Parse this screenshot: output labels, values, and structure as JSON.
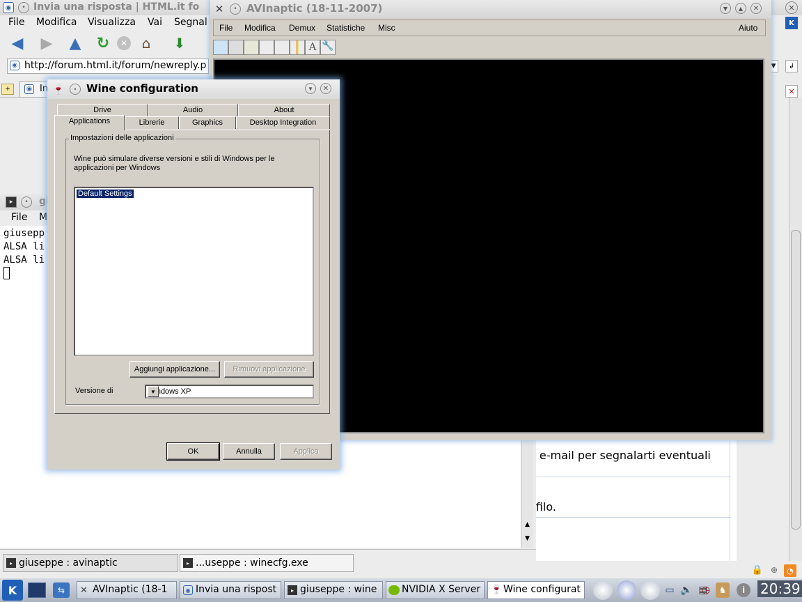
{
  "konqueror": {
    "title": "Invia una risposta | HTML.it fo",
    "menu": [
      "File",
      "Modifica",
      "Visualizza",
      "Vai",
      "Segnal"
    ],
    "url": "http://forum.html.it/forum/newreply.p",
    "tab_label": "Inv",
    "content_lines": [
      "a e-mail per segnalarti eventuali",
      "ofilo."
    ]
  },
  "konsole": {
    "title": "gi",
    "menu": [
      "File",
      "M"
    ],
    "lines": [
      "giusepp",
      "ALSA li",
      "ALSA li"
    ],
    "tabs": [
      "giuseppe : avinaptic",
      "...useppe : winecfg.exe"
    ]
  },
  "avinaptic": {
    "title": "AVInaptic (18-11-2007)",
    "menu": [
      "File",
      "Modifica",
      "Demux",
      "Statistiche",
      "Misc"
    ],
    "help": "Aiuto",
    "toolbar_icons": [
      "open-icon",
      "save-icon",
      "export-icon",
      "list-icon",
      "chart-icon",
      "spectrum-icon",
      "font-icon",
      "wrench-icon"
    ]
  },
  "wine": {
    "title": "Wine configuration",
    "tabs_back": [
      "Drive",
      "Audio",
      "About"
    ],
    "tabs_front": [
      "Applications",
      "Librerie",
      "Graphics",
      "Desktop Integration"
    ],
    "group_caption": "Impostazioni delle applicazioni",
    "description": "Wine può simulare diverse versioni e stili di Windows per le applicazioni per Windows",
    "list_items": [
      "Default Settings"
    ],
    "add_button": "Aggiungi applicazione...",
    "remove_button": "Rimuovi applicazione",
    "version_label": "Versione di",
    "version_value": "Windows XP",
    "ok": "OK",
    "cancel": "Annulla",
    "apply": "Applica"
  },
  "taskbar": {
    "tasks": [
      "AVInaptic (18-1",
      "Invia una rispost",
      "giuseppe : wine",
      "NVIDIA X Server",
      "Wine configurat"
    ],
    "clock": "20:39"
  },
  "colors": {
    "accent_blue": "#0a246a",
    "glow": "#78aae6"
  }
}
